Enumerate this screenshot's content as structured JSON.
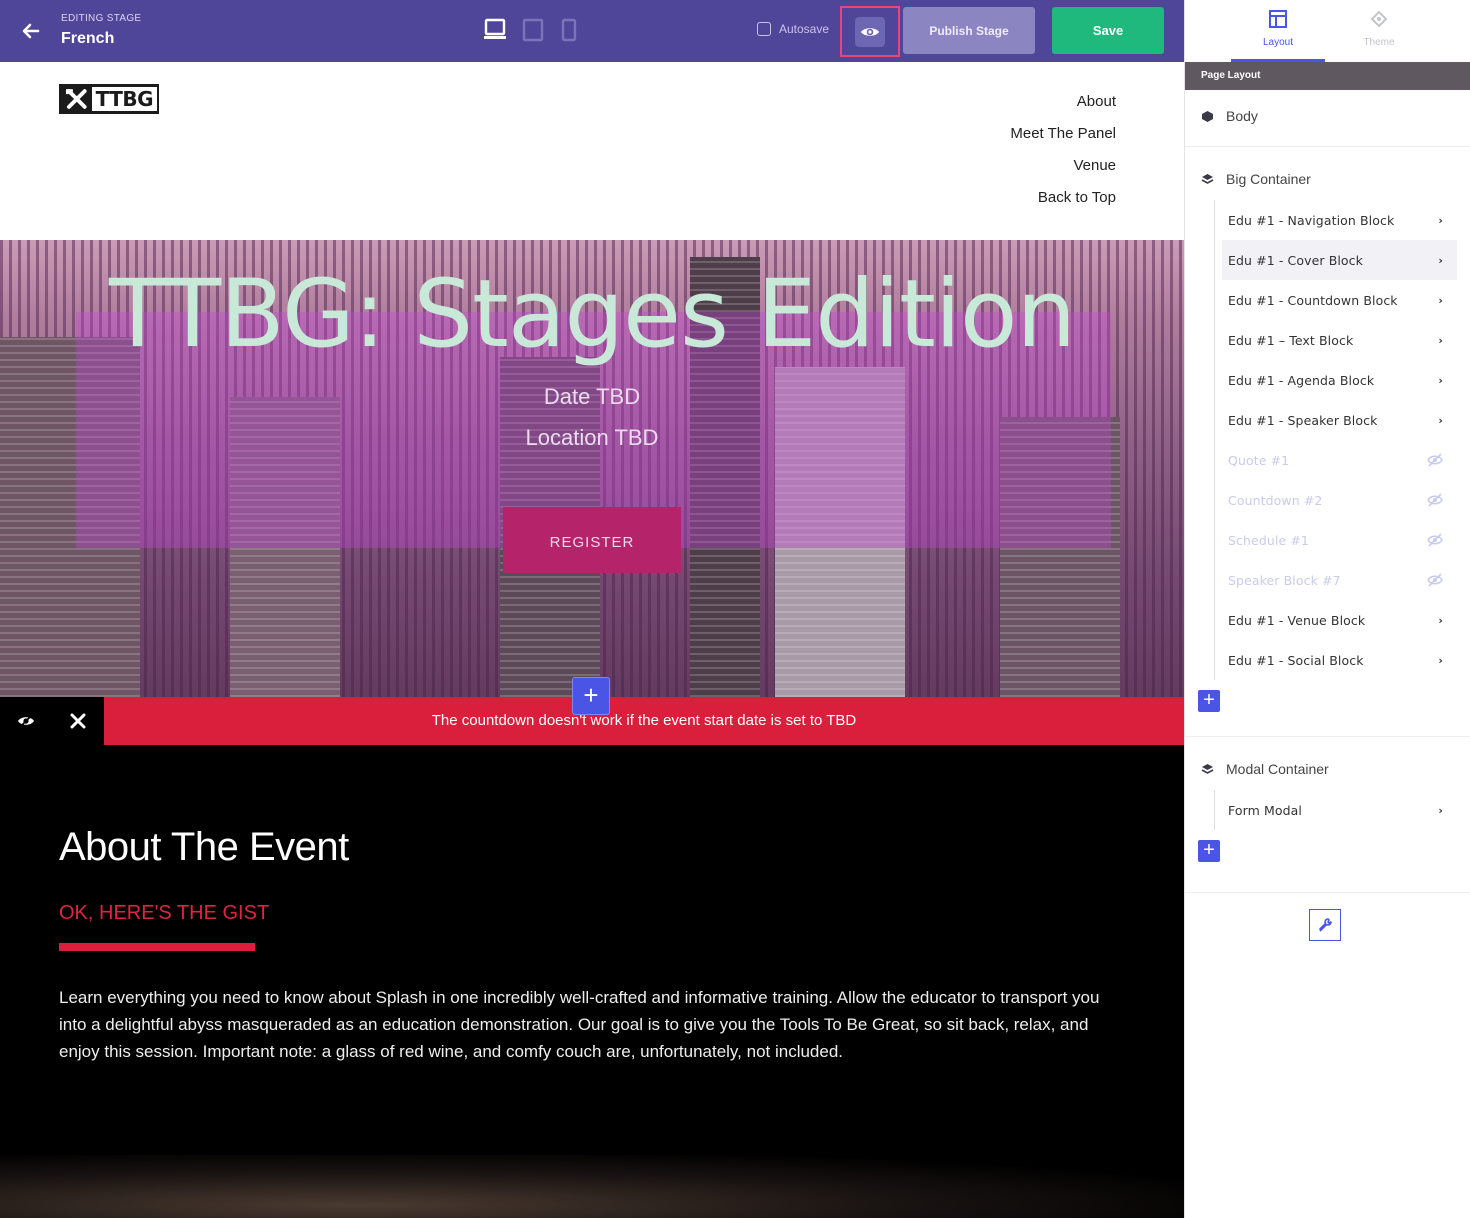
{
  "topbar": {
    "caption": "EDITING STAGE",
    "stage_name": "French",
    "autosave_label": "Autosave",
    "publish_label": "Publish Stage",
    "save_label": "Save"
  },
  "site": {
    "logo_text": "TTBG",
    "nav": [
      "About",
      "Meet The Panel",
      "Venue",
      "Back to Top"
    ],
    "cover": {
      "title": "TTBG: Stages Edition",
      "date": "Date TBD",
      "location": "Location TBD",
      "register": "REGISTER"
    },
    "warning": "The countdown doesn't work if the event start date is set to TBD",
    "about": {
      "heading": "About The Event",
      "subheading": "OK, HERE'S THE GIST",
      "body": "Learn everything you need to know about Splash in one incredibly well-crafted and informative training. Allow the educator to transport you into a delightful abyss masqueraded as an education demonstration. Our goal is to give you the Tools To Be Great, so sit back, relax, and enjoy this session. Important note: a glass of red wine, and comfy couch are, unfortunately, not included."
    }
  },
  "panel": {
    "tabs": {
      "layout": "Layout",
      "theme": "Theme"
    },
    "section_header": "Page Layout",
    "body_label": "Body",
    "big_container": {
      "label": "Big Container",
      "items": [
        {
          "label": "Edu #1 - Navigation Block",
          "hidden": false
        },
        {
          "label": "Edu #1 - Cover Block",
          "hidden": false,
          "selected": true
        },
        {
          "label": "Edu #1 - Countdown Block",
          "hidden": false
        },
        {
          "label": "Edu #1 – Text Block",
          "hidden": false
        },
        {
          "label": "Edu #1 - Agenda Block",
          "hidden": false
        },
        {
          "label": "Edu #1 - Speaker Block",
          "hidden": false
        },
        {
          "label": "Quote #1",
          "hidden": true
        },
        {
          "label": "Countdown #2",
          "hidden": true
        },
        {
          "label": "Schedule #1",
          "hidden": true
        },
        {
          "label": "Speaker Block #7",
          "hidden": true
        },
        {
          "label": "Edu #1 - Venue Block",
          "hidden": false
        },
        {
          "label": "Edu #1 - Social Block",
          "hidden": false
        }
      ]
    },
    "modal_container": {
      "label": "Modal Container",
      "items": [
        {
          "label": "Form Modal",
          "hidden": false
        }
      ]
    }
  },
  "colors": {
    "topbar": "#4f4699",
    "save": "#1fb97e",
    "accent": "#4a55e5",
    "warning": "#d91f3b",
    "preview_highlight": "#e8457f"
  }
}
